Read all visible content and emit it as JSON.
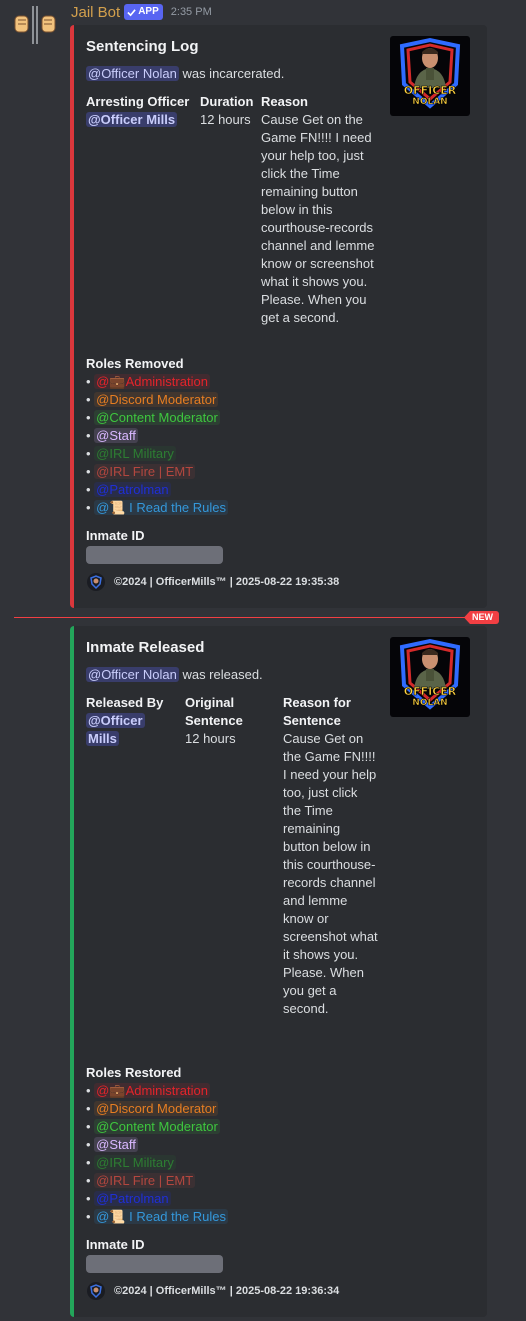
{
  "message": {
    "bot_name": "Jail Bot",
    "app_badge": "APP",
    "time": "2:35 PM"
  },
  "embed1": {
    "title": "Sentencing Log",
    "desc_mention": "@Officer Nolan",
    "desc_text": "was incarcerated.",
    "fields": {
      "officer_label": "Arresting Officer",
      "officer_value": "@Officer Mills",
      "duration_label": "Duration",
      "duration_value": "12 hours",
      "reason_label": "Reason",
      "reason_value": "Cause Get on the Game FN!!!! I need your help too, just click the Time remaining button below in this courthouse-records channel and lemme know or screenshot what it shows you. Please. When you get a second."
    },
    "roles_label": "Roles Removed",
    "inmate_label": "Inmate ID",
    "footer": "©2024 | OfficerMills™ | 2025-08-22 19:35:38"
  },
  "divider_badge": "NEW",
  "embed2": {
    "title": "Inmate Released",
    "desc_mention": "@Officer Nolan",
    "desc_text": "was released.",
    "fields": {
      "released_label": "Released By",
      "released_value_1": "@Officer",
      "released_value_2": "Mills",
      "orig_label_1": "Original",
      "orig_label_2": "Sentence",
      "orig_value": "12 hours",
      "reason_label_1": "Reason for",
      "reason_label_2": "Sentence",
      "reason_value": "Cause Get on the Game FN!!!! I need your help too, just click the Time remaining button below in this courthouse-records channel and lemme know or screenshot what it shows you. Please. When you get a second."
    },
    "roles_label": "Roles Restored",
    "inmate_label": "Inmate ID",
    "footer": "©2024 | OfficerMills™ | 2025-08-22 19:36:34"
  },
  "roles": [
    {
      "prefix": "@",
      "emoji": "💼",
      "name": "Administration",
      "color": "#e3242b",
      "bg": "rgba(227,36,43,0.12)"
    },
    {
      "prefix": "@",
      "emoji": "",
      "name": "Discord Moderator",
      "color": "#e67e22",
      "bg": "rgba(230,126,34,0.12)"
    },
    {
      "prefix": "@",
      "emoji": "",
      "name": "Content Moderator",
      "color": "#3ec73e",
      "bg": "rgba(62,199,62,0.12)"
    },
    {
      "prefix": "@",
      "emoji": "",
      "name": "Staff",
      "color": "#d9b8ff",
      "bg": "rgba(217,184,255,0.15)"
    },
    {
      "prefix": "@",
      "emoji": "",
      "name": "IRL Military",
      "color": "#2d7d32",
      "bg": "rgba(45,125,50,0.12)"
    },
    {
      "prefix": "@",
      "emoji": "",
      "name": "IRL Fire | EMT",
      "color": "#b3473f",
      "bg": "rgba(179,71,63,0.12)"
    },
    {
      "prefix": "@",
      "emoji": "",
      "name": "Patrolman",
      "color": "#1f2fd6",
      "bg": "rgba(31,47,214,0.15)"
    },
    {
      "prefix": "@",
      "emoji": "📜",
      "name": " I Read the Rules",
      "color": "#3498db",
      "bg": "rgba(52,152,219,0.12)"
    }
  ],
  "thumbnail_text": {
    "line1": "OFFICER",
    "line2": "NOLAN"
  },
  "colors": {
    "accent_red": "#da373c",
    "accent_green": "#23a55a",
    "mention_bg": "#3c4270"
  }
}
